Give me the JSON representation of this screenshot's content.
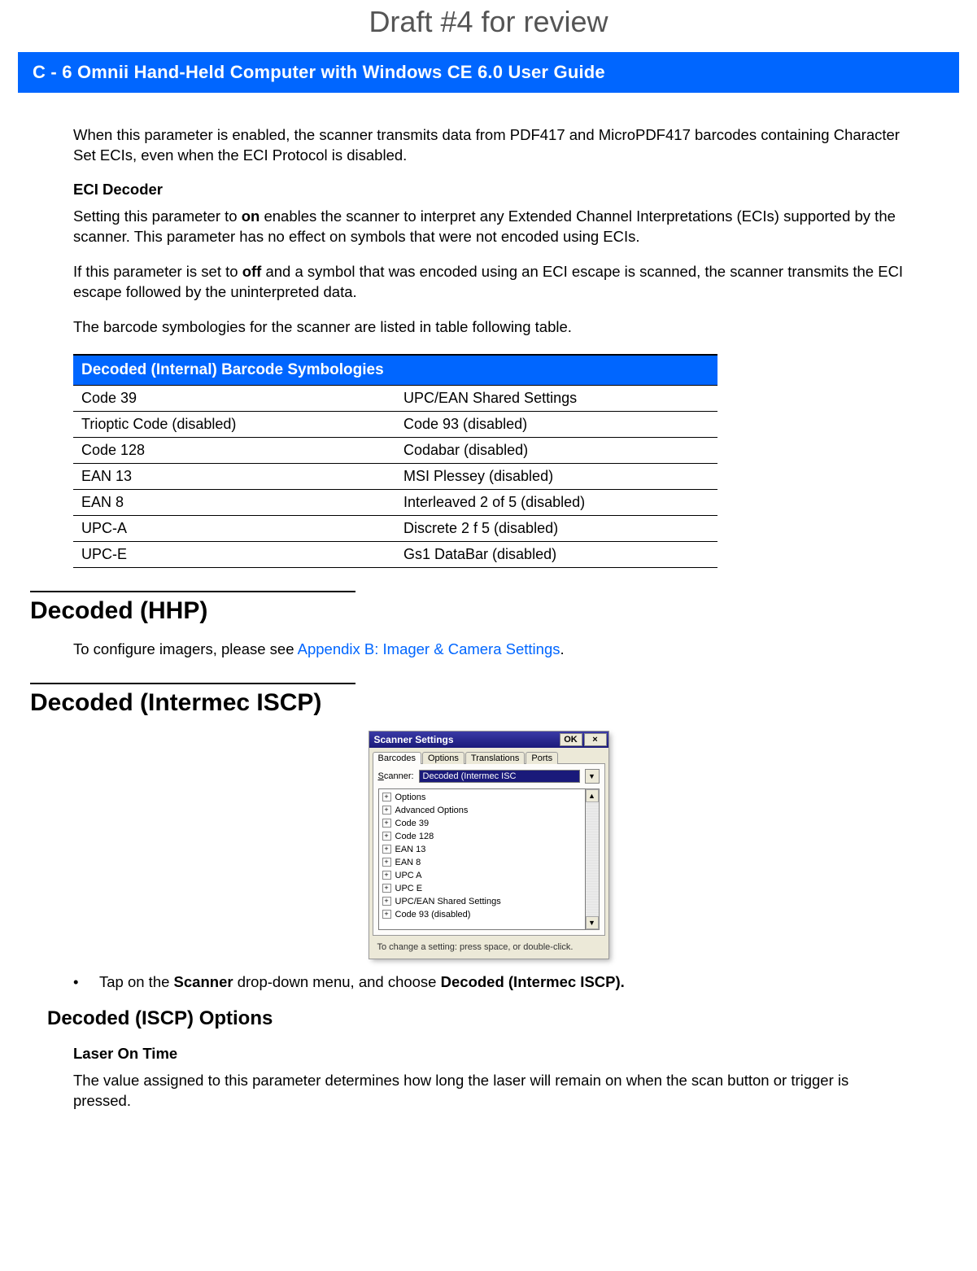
{
  "watermark": "Draft #4 for review",
  "header": "C - 6     Omnii Hand-Held Computer with Windows CE 6.0 User Guide",
  "intro_para": "When this parameter is enabled, the scanner transmits data from PDF417 and MicroPDF417 barcodes containing Character Set ECIs, even when the ECI Protocol is disabled.",
  "eci_decoder_head": "ECI Decoder",
  "eci_p1a": "Setting this parameter to ",
  "eci_p1_on": "on",
  "eci_p1b": " enables the scanner to interpret any Extended Channel Interpretations (ECIs) supported by the scanner. This parameter has no effect on symbols that were not encoded using ECIs.",
  "eci_p2a": "If this parameter is set to ",
  "eci_p2_off": "off",
  "eci_p2b": " and a symbol that was encoded using an ECI escape is scanned, the scanner transmits the ECI escape followed by the uninterpreted data.",
  "eci_p3": "The barcode symbologies for the scanner are listed in table following table.",
  "table_title": "Decoded (Internal) Barcode Symbologies",
  "sym_rows": [
    [
      "Code 39",
      "UPC/EAN Shared Settings"
    ],
    [
      "Trioptic Code (disabled)",
      "Code 93 (disabled)"
    ],
    [
      "Code 128",
      "Codabar (disabled)"
    ],
    [
      "EAN 13",
      "MSI Plessey (disabled)"
    ],
    [
      "EAN 8",
      "Interleaved 2 of 5 (disabled)"
    ],
    [
      "UPC-A",
      "Discrete 2 f 5 (disabled)"
    ],
    [
      "UPC-E",
      "Gs1 DataBar (disabled)"
    ]
  ],
  "hhp_title": "Decoded (HHP)",
  "hhp_para_a": "To configure imagers, please see ",
  "hhp_link": "Appendix B: Imager & Camera Settings",
  "hhp_para_b": ".",
  "iscp_title": "Decoded (Intermec ISCP)",
  "dlg": {
    "title": "Scanner Settings",
    "ok": "OK",
    "close": "×",
    "tabs": [
      "Barcodes",
      "Options",
      "Translations",
      "Ports"
    ],
    "scanner_label": "Scanner:",
    "scanner_value": "Decoded (Intermec ISC",
    "tree": [
      "Options",
      "Advanced Options",
      "Code 39",
      "Code 128",
      "EAN 13",
      "EAN 8",
      "UPC A",
      "UPC E",
      "UPC/EAN Shared Settings",
      "Code 93 (disabled)"
    ],
    "hint": "To change a setting: press space, or double-click."
  },
  "bullet_a": "Tap on the ",
  "bullet_b1": "Scanner",
  "bullet_c": " drop-down menu, and choose ",
  "bullet_b2": "Decoded (Intermec ISCP).",
  "iscp_opts_title": "Decoded (ISCP) Options",
  "laser_head": "Laser On Time",
  "laser_para": "The value assigned to this parameter determines how long the laser will remain on when the scan button or trigger is pressed."
}
